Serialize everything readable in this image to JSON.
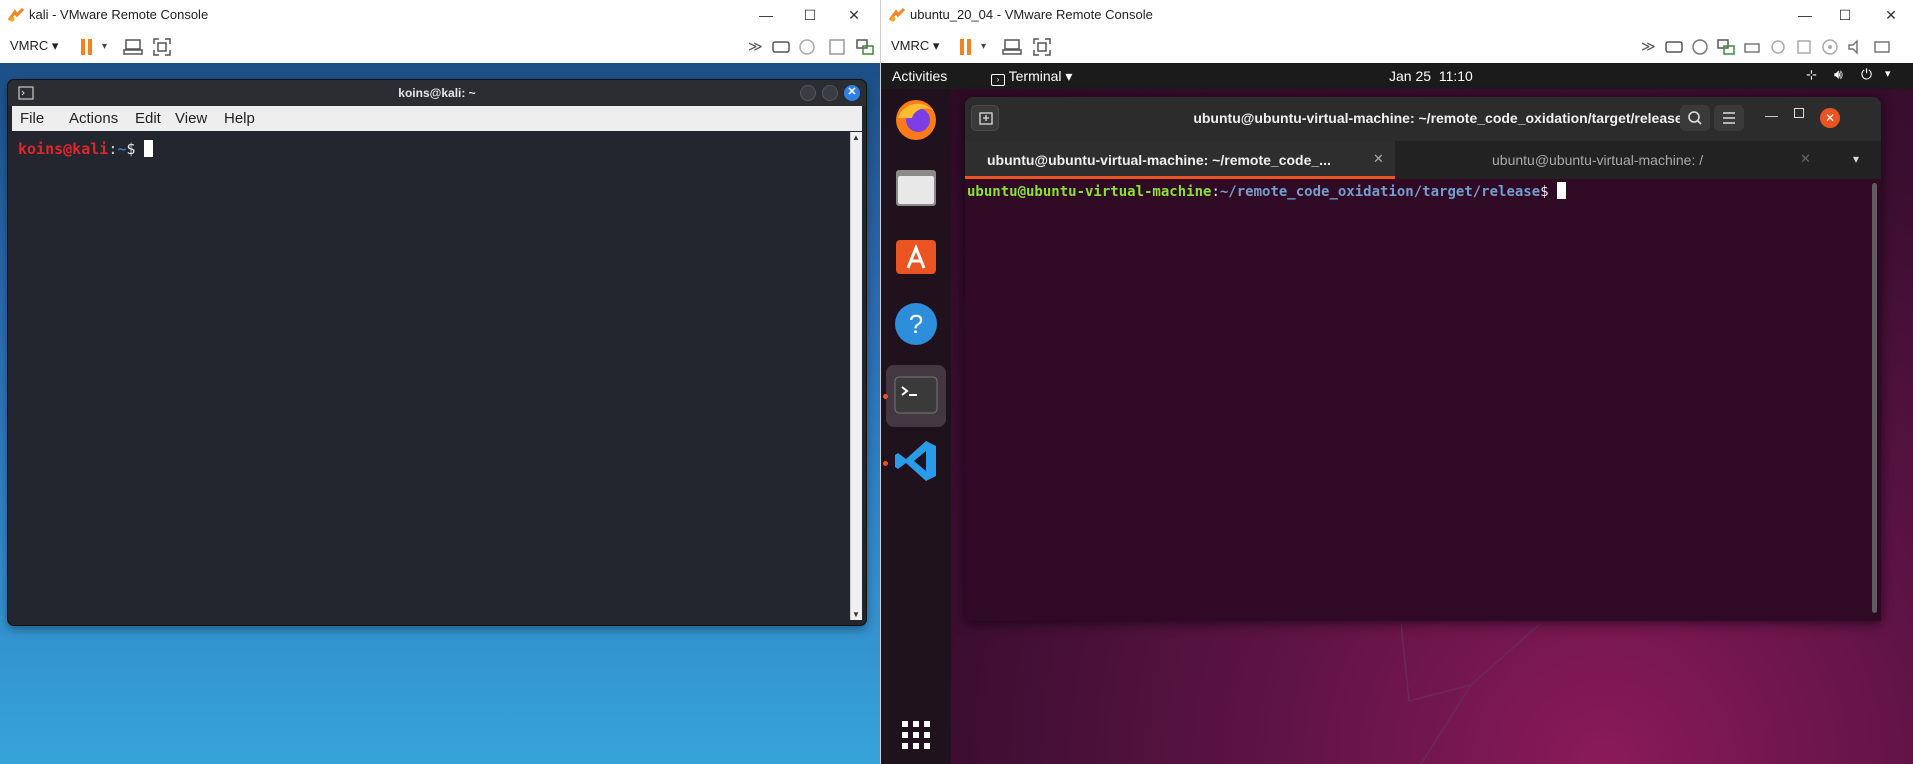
{
  "left_window": {
    "title": "kali - VMware Remote Console",
    "vmrc_menu": "VMRC",
    "terminal": {
      "title": "koins@kali: ~",
      "menu": [
        "File",
        "Actions",
        "Edit",
        "View",
        "Help"
      ],
      "prompt_user": "koins@kali",
      "prompt_sep": ":",
      "prompt_path": "~",
      "prompt_symbol": "$"
    }
  },
  "right_window": {
    "title": "ubuntu_20_04 - VMware Remote Console",
    "vmrc_menu": "VMRC",
    "topbar": {
      "activities": "Activities",
      "app_menu": "Terminal",
      "date": "Jan 25",
      "time": "11:10"
    },
    "dock": {
      "items": [
        "firefox-icon",
        "files-icon",
        "software-icon",
        "help-icon",
        "terminal-icon",
        "vscode-icon",
        "app-grid-icon"
      ]
    },
    "terminal": {
      "title": "ubuntu@ubuntu-virtual-machine: ~/remote_code_oxidation/target/release",
      "tabs": [
        {
          "label": "ubuntu@ubuntu-virtual-machine: ~/remote_code_...",
          "active": true
        },
        {
          "label": "ubuntu@ubuntu-virtual-machine: /",
          "active": false
        }
      ],
      "prompt_user": "ubuntu@ubuntu-virtual-machine",
      "prompt_sep": ":",
      "prompt_path": "~/remote_code_oxidation/target/release",
      "prompt_symbol": "$"
    }
  },
  "colors": {
    "kali_prompt_red": "#e0262b",
    "ubuntu_prompt_green": "#8ae234",
    "ubuntu_prompt_blue": "#729fcf",
    "ubuntu_terminal_bg": "#300a24",
    "vmrc_pause_orange": "#f5821f"
  }
}
